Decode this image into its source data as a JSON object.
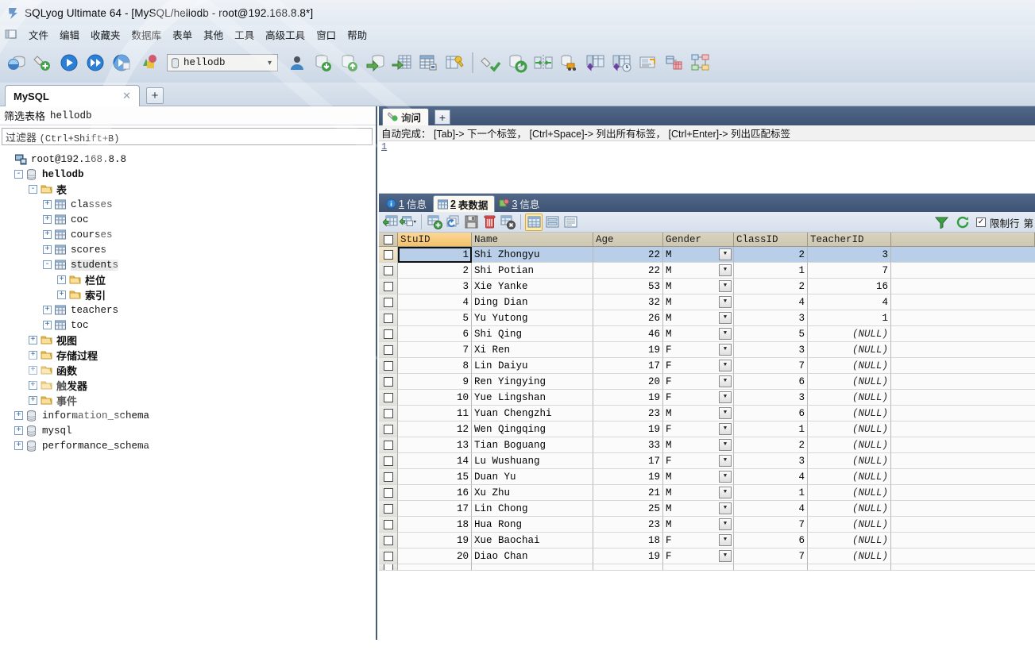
{
  "window": {
    "title": "SQLyog Ultimate 64 - [MySQL/hellodb - root@192.168.8.8*]",
    "app_icon": "sqlyog-logo-icon"
  },
  "menubar": {
    "icon": "window-restore-icon",
    "items": [
      {
        "label": "文件",
        "name": "menu-file"
      },
      {
        "label": "编辑",
        "name": "menu-edit"
      },
      {
        "label": "收藏夹",
        "name": "menu-favorites"
      },
      {
        "label": "数据库",
        "name": "menu-database"
      },
      {
        "label": "表单",
        "name": "menu-table"
      },
      {
        "label": "其他",
        "name": "menu-other"
      },
      {
        "label": "工具",
        "name": "menu-tools"
      },
      {
        "label": "高级工具",
        "name": "menu-powertools"
      },
      {
        "label": "窗口",
        "name": "menu-window"
      },
      {
        "label": "帮助",
        "name": "menu-help"
      }
    ]
  },
  "toolbar": {
    "database_selector": {
      "value": "hellodb",
      "icon": "database-icon",
      "caret": "chevron-down-icon"
    },
    "buttons": [
      {
        "name": "new-connection-icon"
      },
      {
        "name": "new-query-tab-icon"
      },
      {
        "name": "execute-query-icon"
      },
      {
        "name": "execute-all-queries-icon"
      },
      {
        "name": "execute-current-query-icon"
      },
      {
        "name": "stop-query-icon"
      }
    ],
    "buttons_right": [
      {
        "name": "user-manager-icon"
      },
      {
        "name": "import-database-icon"
      },
      {
        "name": "export-database-icon"
      },
      {
        "name": "backup-database-icon"
      },
      {
        "name": "restore-table-icon"
      },
      {
        "name": "create-table-icon"
      },
      {
        "name": "manage-indexes-icon"
      },
      {
        "name": "flush-icon"
      },
      {
        "name": "sync-database-icon"
      },
      {
        "name": "compare-schema-icon"
      },
      {
        "name": "migrate-data-icon"
      },
      {
        "name": "scheduled-backup-icon"
      },
      {
        "name": "notifications-icon"
      },
      {
        "name": "query-builder-icon"
      },
      {
        "name": "schema-designer-icon"
      }
    ]
  },
  "connection_tabs": {
    "tabs": [
      {
        "label": "MySQL",
        "close_icon": "close-icon",
        "active": true
      }
    ],
    "add_label": "+"
  },
  "sidebar": {
    "filter_header": {
      "zh": "筛选表格",
      "db": "hellodb"
    },
    "filter_input": {
      "placeholder_zh": "过滤器",
      "placeholder_shortcut": "(Ctrl+Shift+B)",
      "value": ""
    },
    "tree": [
      {
        "label": "root@192.168.8.8",
        "indent": 0,
        "expander": "",
        "icon": "server-icon",
        "font": "mono",
        "bold": false
      },
      {
        "label": "hellodb",
        "indent": 1,
        "expander": "-",
        "icon": "database-icon",
        "font": "mono",
        "bold": true
      },
      {
        "label": "表",
        "indent": 2,
        "expander": "-",
        "icon": "folder-icon",
        "font": "zh",
        "bold": true
      },
      {
        "label": "classes",
        "indent": 3,
        "expander": "+",
        "icon": "table-icon",
        "font": "mono",
        "bold": false
      },
      {
        "label": "coc",
        "indent": 3,
        "expander": "+",
        "icon": "table-icon",
        "font": "mono",
        "bold": false
      },
      {
        "label": "courses",
        "indent": 3,
        "expander": "+",
        "icon": "table-icon",
        "font": "mono",
        "bold": false
      },
      {
        "label": "scores",
        "indent": 3,
        "expander": "+",
        "icon": "table-icon",
        "font": "mono",
        "bold": false
      },
      {
        "label": "students",
        "indent": 3,
        "expander": "-",
        "icon": "table-icon",
        "font": "mono",
        "bold": false,
        "selected": true
      },
      {
        "label": "栏位",
        "indent": 4,
        "expander": "+",
        "icon": "folder-icon",
        "font": "zh",
        "bold": true
      },
      {
        "label": "索引",
        "indent": 4,
        "expander": "+",
        "icon": "folder-icon",
        "font": "zh",
        "bold": true
      },
      {
        "label": "teachers",
        "indent": 3,
        "expander": "+",
        "icon": "table-icon",
        "font": "mono",
        "bold": false
      },
      {
        "label": "toc",
        "indent": 3,
        "expander": "+",
        "icon": "table-icon",
        "font": "mono",
        "bold": false
      },
      {
        "label": "视图",
        "indent": 2,
        "expander": "+",
        "icon": "folder-icon",
        "font": "zh",
        "bold": true
      },
      {
        "label": "存储过程",
        "indent": 2,
        "expander": "+",
        "icon": "folder-icon",
        "font": "zh",
        "bold": true
      },
      {
        "label": "函数",
        "indent": 2,
        "expander": "+",
        "icon": "folder-icon",
        "font": "zh",
        "bold": true
      },
      {
        "label": "触发器",
        "indent": 2,
        "expander": "+",
        "icon": "folder-icon",
        "font": "zh",
        "bold": true
      },
      {
        "label": "事件",
        "indent": 2,
        "expander": "+",
        "icon": "folder-icon",
        "font": "zh",
        "bold": true
      },
      {
        "label": "information_schema",
        "indent": 1,
        "expander": "+",
        "icon": "database-icon",
        "font": "mono",
        "bold": false
      },
      {
        "label": "mysql",
        "indent": 1,
        "expander": "+",
        "icon": "database-icon",
        "font": "mono",
        "bold": false
      },
      {
        "label": "performance_schema",
        "indent": 1,
        "expander": "+",
        "icon": "database-icon",
        "font": "mono",
        "bold": false
      }
    ]
  },
  "query_panel": {
    "tab_label": "询问",
    "tab_icon": "query-icon",
    "add_label": "+",
    "autocomplete_hint": "自动完成： [Tab]-> 下一个标签， [Ctrl+Space]-> 列出所有标签， [Ctrl+Enter]-> 列出匹配标签",
    "editor_line_number": "1",
    "editor_text": ""
  },
  "result_tabs": [
    {
      "num": "1",
      "label": "信息",
      "icon": "info-icon",
      "active": false
    },
    {
      "num": "2",
      "label": "表数据",
      "icon": "table-data-icon",
      "active": true
    },
    {
      "num": "3",
      "label": "信息",
      "icon": "message-icon",
      "active": false
    }
  ],
  "grid_toolbar": {
    "buttons": [
      {
        "name": "insert-row-icon"
      },
      {
        "name": "insert-row-dropdown-icon"
      },
      {
        "name": "add-new-row-icon"
      },
      {
        "name": "duplicate-row-icon"
      },
      {
        "name": "save-changes-icon"
      },
      {
        "name": "delete-row-icon"
      },
      {
        "name": "discard-changes-icon"
      },
      {
        "name": "grid-view-icon"
      },
      {
        "name": "form-view-icon"
      },
      {
        "name": "text-view-icon"
      }
    ],
    "right": {
      "filter_icon": "funnel-filter-icon",
      "refresh_icon": "refresh-icon",
      "limit_checkbox_checked": true,
      "limit_label": "限制行",
      "page_label": "第"
    }
  },
  "table_grid": {
    "columns": [
      {
        "key": "StuID",
        "label": "StuID",
        "primary": true
      },
      {
        "key": "Name",
        "label": "Name",
        "primary": false
      },
      {
        "key": "Age",
        "label": "Age",
        "primary": false
      },
      {
        "key": "Gender",
        "label": "Gender",
        "primary": false
      },
      {
        "key": "ClassID",
        "label": "ClassID",
        "primary": false
      },
      {
        "key": "TeacherID",
        "label": "TeacherID",
        "primary": false
      }
    ],
    "rows": [
      {
        "StuID": "1",
        "Name": "Shi Zhongyu",
        "Age": "22",
        "Gender": "M",
        "ClassID": "2",
        "TeacherID": "3",
        "selected": true
      },
      {
        "StuID": "2",
        "Name": "Shi Potian",
        "Age": "22",
        "Gender": "M",
        "ClassID": "1",
        "TeacherID": "7",
        "selected": false
      },
      {
        "StuID": "3",
        "Name": "Xie Yanke",
        "Age": "53",
        "Gender": "M",
        "ClassID": "2",
        "TeacherID": "16",
        "selected": false
      },
      {
        "StuID": "4",
        "Name": "Ding Dian",
        "Age": "32",
        "Gender": "M",
        "ClassID": "4",
        "TeacherID": "4",
        "selected": false
      },
      {
        "StuID": "5",
        "Name": "Yu Yutong",
        "Age": "26",
        "Gender": "M",
        "ClassID": "3",
        "TeacherID": "1",
        "selected": false
      },
      {
        "StuID": "6",
        "Name": "Shi Qing",
        "Age": "46",
        "Gender": "M",
        "ClassID": "5",
        "TeacherID": "(NULL)",
        "selected": false
      },
      {
        "StuID": "7",
        "Name": "Xi Ren",
        "Age": "19",
        "Gender": "F",
        "ClassID": "3",
        "TeacherID": "(NULL)",
        "selected": false
      },
      {
        "StuID": "8",
        "Name": "Lin Daiyu",
        "Age": "17",
        "Gender": "F",
        "ClassID": "7",
        "TeacherID": "(NULL)",
        "selected": false
      },
      {
        "StuID": "9",
        "Name": "Ren Yingying",
        "Age": "20",
        "Gender": "F",
        "ClassID": "6",
        "TeacherID": "(NULL)",
        "selected": false
      },
      {
        "StuID": "10",
        "Name": "Yue Lingshan",
        "Age": "19",
        "Gender": "F",
        "ClassID": "3",
        "TeacherID": "(NULL)",
        "selected": false
      },
      {
        "StuID": "11",
        "Name": "Yuan Chengzhi",
        "Age": "23",
        "Gender": "M",
        "ClassID": "6",
        "TeacherID": "(NULL)",
        "selected": false
      },
      {
        "StuID": "12",
        "Name": "Wen Qingqing",
        "Age": "19",
        "Gender": "F",
        "ClassID": "1",
        "TeacherID": "(NULL)",
        "selected": false
      },
      {
        "StuID": "13",
        "Name": "Tian Boguang",
        "Age": "33",
        "Gender": "M",
        "ClassID": "2",
        "TeacherID": "(NULL)",
        "selected": false
      },
      {
        "StuID": "14",
        "Name": "Lu Wushuang",
        "Age": "17",
        "Gender": "F",
        "ClassID": "3",
        "TeacherID": "(NULL)",
        "selected": false
      },
      {
        "StuID": "15",
        "Name": "Duan Yu",
        "Age": "19",
        "Gender": "M",
        "ClassID": "4",
        "TeacherID": "(NULL)",
        "selected": false
      },
      {
        "StuID": "16",
        "Name": "Xu Zhu",
        "Age": "21",
        "Gender": "M",
        "ClassID": "1",
        "TeacherID": "(NULL)",
        "selected": false
      },
      {
        "StuID": "17",
        "Name": "Lin Chong",
        "Age": "25",
        "Gender": "M",
        "ClassID": "4",
        "TeacherID": "(NULL)",
        "selected": false
      },
      {
        "StuID": "18",
        "Name": "Hua Rong",
        "Age": "23",
        "Gender": "M",
        "ClassID": "7",
        "TeacherID": "(NULL)",
        "selected": false
      },
      {
        "StuID": "19",
        "Name": "Xue Baochai",
        "Age": "18",
        "Gender": "F",
        "ClassID": "6",
        "TeacherID": "(NULL)",
        "selected": false
      },
      {
        "StuID": "20",
        "Name": "Diao Chan",
        "Age": "19",
        "Gender": "F",
        "ClassID": "7",
        "TeacherID": "(NULL)",
        "selected": false
      }
    ],
    "dropdown_icon": "chevron-down-icon",
    "row_checkbox_icon": "checkbox-icon"
  },
  "colors": {
    "titlebar": "#e7eef6",
    "toolbar": "#d6e0ec",
    "tab_active_bg": "#ffffff",
    "panel_border": "#4a5a74",
    "grid_header": "#cdc6b1",
    "grid_header_key": "#f3c268",
    "row_selected": "#b9cfe9",
    "result_tabbar": "#45597a"
  }
}
